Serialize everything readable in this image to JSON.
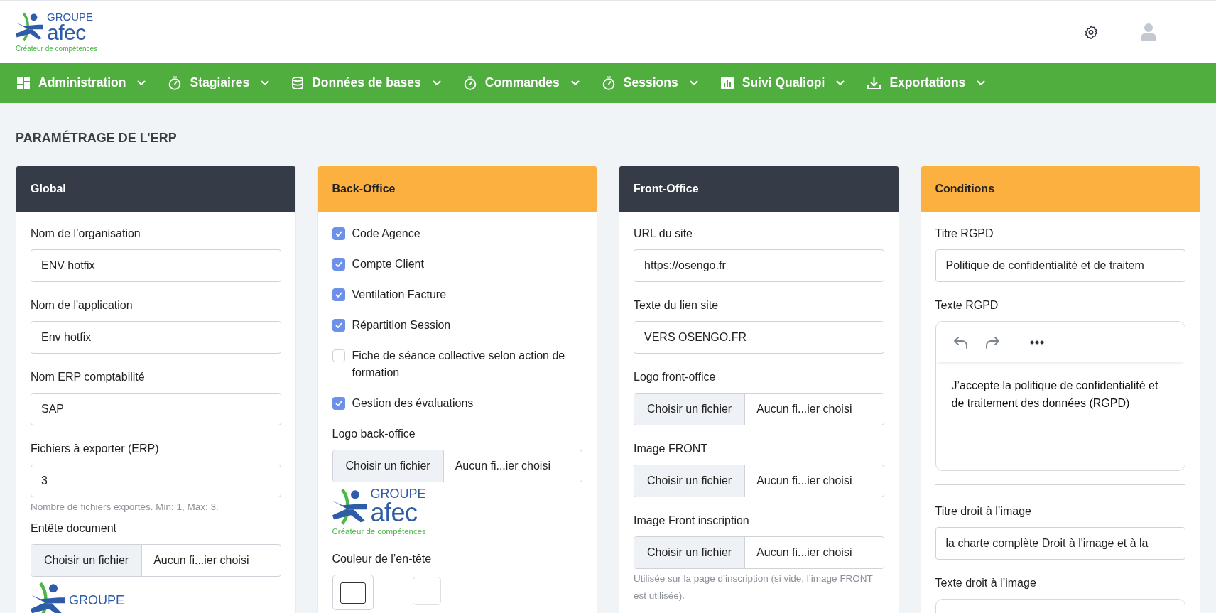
{
  "header": {
    "logo": {
      "line1": "GROUPE",
      "line2": "afec",
      "tagline": "Créateur de compétences"
    }
  },
  "nav": [
    {
      "label": "Administration",
      "kind": "grid"
    },
    {
      "label": "Stagiaires",
      "kind": "timer"
    },
    {
      "label": "Données de bases",
      "kind": "database"
    },
    {
      "label": "Commandes",
      "kind": "timer"
    },
    {
      "label": "Sessions",
      "kind": "timer"
    },
    {
      "label": "Suivi Qualiopi",
      "kind": "chart"
    },
    {
      "label": "Exportations",
      "kind": "download"
    }
  ],
  "page_title": "PARAMÉTRAGE DE L’ERP",
  "cards": [
    {
      "title": "Global",
      "color": "#353b47",
      "fields": [
        {
          "kind": "text",
          "label": "Nom de l’organisation",
          "value": "ENV hotfix"
        },
        {
          "kind": "text",
          "label": "Nom de l'application",
          "value": "Env hotfix"
        },
        {
          "kind": "text",
          "label": "Nom ERP comptabilité",
          "value": "SAP"
        },
        {
          "kind": "text",
          "label": "Fichiers à exporter (ERP)",
          "value": "3",
          "hint": "Nombre de fichiers exportés. Min: 1, Max: 3."
        },
        {
          "kind": "file",
          "label": "Entête document",
          "button": "Choisir un fichier",
          "status": "Aucun fi...ier choisi"
        },
        {
          "kind": "logo",
          "line1": "GROUPE"
        }
      ]
    },
    {
      "title": "Back-Office",
      "color": "#fbb040",
      "fields": [
        {
          "kind": "checkbox",
          "label": "Code Agence",
          "checked": true
        },
        {
          "kind": "checkbox",
          "label": "Compte Client",
          "checked": true
        },
        {
          "kind": "checkbox",
          "label": "Ventilation Facture",
          "checked": true
        },
        {
          "kind": "checkbox",
          "label": "Répartition Session",
          "checked": true
        },
        {
          "kind": "checkbox",
          "label": "Fiche de séance collective selon action de formation",
          "checked": false
        },
        {
          "kind": "checkbox",
          "label": "Gestion des évaluations",
          "checked": true
        },
        {
          "kind": "file",
          "label": "Logo back-office",
          "button": "Choisir un fichier",
          "status": "Aucun fi...ier choisi"
        },
        {
          "kind": "logo",
          "line1": "GROUPE",
          "line2": "afec",
          "tagline": "Créateur de compétences"
        },
        {
          "kind": "color",
          "label": "Couleur de l’en-tête"
        }
      ]
    },
    {
      "title": "Front-Office",
      "color": "#353b47",
      "fields": [
        {
          "kind": "text",
          "label": "URL du site",
          "value": "https://osengo.fr"
        },
        {
          "kind": "text",
          "label": "Texte du lien site",
          "value": "VERS OSENGO.FR"
        },
        {
          "kind": "file",
          "label": "Logo front-office",
          "button": "Choisir un fichier",
          "status": "Aucun fi...ier choisi"
        },
        {
          "kind": "file",
          "label": "Image FRONT",
          "button": "Choisir un fichier",
          "status": "Aucun fi...ier choisi"
        },
        {
          "kind": "file",
          "label": "Image Front inscription",
          "button": "Choisir un fichier",
          "status": "Aucun fi...ier choisi",
          "hint": "Utilisée sur la page d’inscription (si vide, l’image FRONT est utilisée)."
        }
      ]
    },
    {
      "title": "Conditions",
      "color": "#fbb040",
      "fields": [
        {
          "kind": "text",
          "label": "Titre RGPD",
          "value": "Politique de confidentialité et de traitem"
        },
        {
          "kind": "editor",
          "label": "Texte RGPD",
          "text": "J’accepte la politique de confidentialité et de traitement des données (RGPD)"
        },
        {
          "kind": "divider"
        },
        {
          "kind": "text",
          "label": "Titre droit à l’image",
          "value": "la charte complète Droit à l'image et à la"
        },
        {
          "kind": "editor",
          "label": "Texte droit à l’image"
        }
      ]
    }
  ]
}
